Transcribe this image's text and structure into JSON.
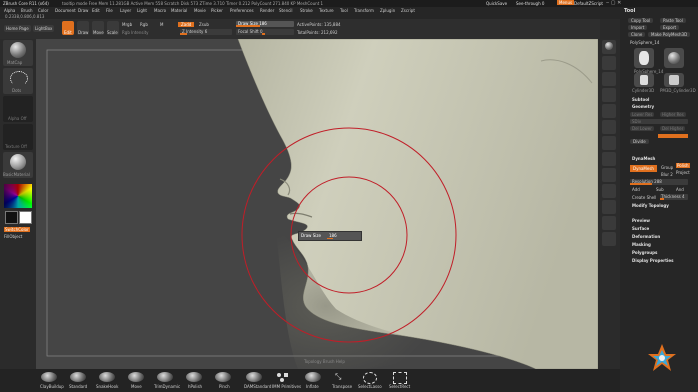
{
  "titlebar": {
    "app": "ZBrush Core R11 (x64)",
    "info": "tooltip mode   Free Mem 11.281GB  Active Mem 558  Scratch Disk 573  ZTime 3.710  Timer 0.212  PolyCount 271.840 KP  MeshCount 1",
    "quicksave": "QuickSave",
    "see_through": "See-through  0",
    "menus_btn": "Menus",
    "script": "DefaultZScript"
  },
  "menubar": [
    "Alpha",
    "Brush",
    "Color",
    "Document",
    "Draw",
    "Edit",
    "File",
    "Layer",
    "Light",
    "Macro",
    "Material",
    "Movie",
    "Picker",
    "Preferences",
    "Render",
    "Stencil",
    "Stroke",
    "Texture",
    "Tool",
    "Transform",
    "Zplugin",
    "Zscript"
  ],
  "subbar": "0.2338,0.806,0.813",
  "toolbar": {
    "home_page": "Home Page",
    "lightbox": "LightBox",
    "edit": "Edit",
    "draw": "Draw",
    "move": "Move",
    "scale": "Scale",
    "rotate": "Rotate",
    "mrgb": "Mrgb",
    "rgb": "Rgb",
    "m": "M",
    "zadd": "Zadd",
    "zsub": "Zsub",
    "rgb_intensity": "Rgb Intensity",
    "z_intensity": "Z Intensity 6",
    "draw_size": "Draw Size 186",
    "focal_shift": "Focal Shift 0",
    "active_points": "ActivePoints: 135,884",
    "total_points": "TotalPoints: 212,692"
  },
  "left_shelf": {
    "materials": [
      "MatCap",
      "Dots",
      "Alpha Off",
      "Texture Off",
      "BasicMaterial"
    ],
    "color_labels": [
      "SwitchColor",
      "FillObject"
    ]
  },
  "tray": {
    "title": "Tool",
    "row1": [
      "Copy Tool",
      "Paste Tool"
    ],
    "row2": [
      "Import",
      "Export"
    ],
    "row3": [
      "Clone",
      "Make PolyMesh3D"
    ],
    "polysphere": "PolySphere_14",
    "thumbs": [
      "PolySphere_14",
      "Polysphere",
      "SimpleBrush",
      "Cylinder3D",
      "Cylinder_PM",
      "PM3D_Cylinder3D"
    ],
    "subtool": "Subtool",
    "geometry": "Geometry",
    "lower_res": "Lower Res",
    "higher_res": "Higher Res",
    "sdiv": "SDiv",
    "del_lower": "Del Lower",
    "del_higher": "Del Higher",
    "divide": "Divide",
    "dynamesh_hdr": "DynaMesh",
    "dynamesh": "DynaMesh",
    "group": "Group",
    "polish": "Polish",
    "project": "Project",
    "blur": "Blur 2",
    "resolution": "Resolution 288",
    "add": "Add",
    "sub": "Sub",
    "and": "And",
    "create_shell": "Create Shell",
    "thickness": "Thickness 4",
    "modify_topology": "Modify Topology",
    "sections": [
      "Preview",
      "Surface",
      "Deformation",
      "Masking",
      "Polygroups",
      "Display Properties"
    ]
  },
  "bottom_brushes": [
    "ClayBuildup",
    "Standard",
    "SnakeHook",
    "Move",
    "TrimDynamic",
    "hPolish",
    "Pinch",
    "DAMStandard",
    "IMM Primitives",
    "Inflate",
    "Transpose",
    "SelectLasso",
    "SelectRect"
  ],
  "canvas": {
    "popup_label": "Draw Size",
    "popup_value": "186",
    "footer": "Topology Brush Help"
  },
  "colors": {
    "accent": "#e0701e",
    "brush_ring": "#c01e28",
    "skin": "#cfcfb9"
  }
}
